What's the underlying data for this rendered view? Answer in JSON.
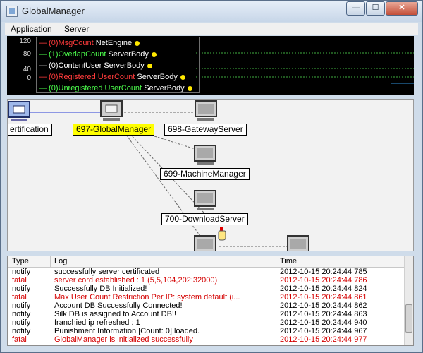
{
  "window": {
    "title": "GlobalManager",
    "min_glyph": "—",
    "max_glyph": "☐",
    "close_glyph": "✕"
  },
  "menu": {
    "items": [
      "Application",
      "Server"
    ]
  },
  "graph": {
    "y_ticks": [
      "120",
      "80",
      "40",
      "0"
    ],
    "legend": [
      {
        "prefix": "— (0)",
        "name": "MsgCount",
        "host": "NetEngine",
        "color": "#ff3b3b"
      },
      {
        "prefix": "— (1)",
        "name": "OverlapCount",
        "host": "ServerBody",
        "color": "#4cff4c"
      },
      {
        "prefix": "— (0)",
        "name": "ContentUser",
        "host": "ServerBody",
        "color": "#ffffff"
      },
      {
        "prefix": "— (0)",
        "name": "Registered UserCount",
        "host": "ServerBody",
        "color": "#ff3b3b"
      },
      {
        "prefix": "— (0)",
        "name": "Unregistered UserCount",
        "host": "ServerBody",
        "color": "#4cff4c"
      }
    ]
  },
  "network": {
    "nodes": [
      {
        "name": "certification-node",
        "label": "ertification",
        "selected": false
      },
      {
        "name": "globalmanager-node",
        "label": "697-GlobalManager",
        "selected": true
      },
      {
        "name": "gatewayserver-node",
        "label": "698-GatewayServer",
        "selected": false
      },
      {
        "name": "machinemanager-node",
        "label": "699-MachineManager",
        "selected": false
      },
      {
        "name": "downloadserver-node",
        "label": "700-DownloadServer",
        "selected": false
      }
    ]
  },
  "log": {
    "headers": {
      "type": "Type",
      "log": "Log",
      "time": "Time"
    },
    "rows": [
      {
        "type": "notify",
        "log": "successfully server certificated",
        "time": "2012-10-15 20:24:44 785",
        "color": "#000000"
      },
      {
        "type": "fatal",
        "log": "server cord established : 1 (5,5,104,202:32000)",
        "time": "2012-10-15 20:24:44 786",
        "color": "#d40000"
      },
      {
        "type": "notify",
        "log": "Successfully DB Initialized!",
        "time": "2012-10-15 20:24:44 824",
        "color": "#000000"
      },
      {
        "type": "fatal",
        "log": "Max User Count Restriction Per IP: system default (i...",
        "time": "2012-10-15 20:24:44 861",
        "color": "#d40000"
      },
      {
        "type": "notify",
        "log": "Account DB Successfully Connected!",
        "time": "2012-10-15 20:24:44 862",
        "color": "#000000"
      },
      {
        "type": "notify",
        "log": "Silk DB is assigned to Account DB!!",
        "time": "2012-10-15 20:24:44 863",
        "color": "#000000"
      },
      {
        "type": "notify",
        "log": "franchied ip refreshed : 1",
        "time": "2012-10-15 20:24:44 940",
        "color": "#000000"
      },
      {
        "type": "notify",
        "log": "Punishment Information [Count: 0] loaded.",
        "time": "2012-10-15 20:24:44 967",
        "color": "#000000"
      },
      {
        "type": "fatal",
        "log": "GlobalManager is initialized successfully",
        "time": "2012-10-15 20:24:44 977",
        "color": "#d40000"
      }
    ]
  }
}
